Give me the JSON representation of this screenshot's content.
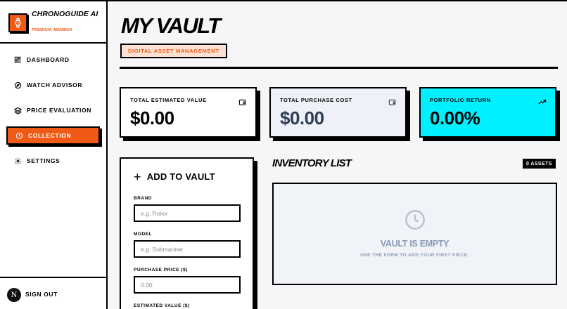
{
  "brand": {
    "title": "CHRONOGUIDE AI",
    "subtitle": "PREMIUM_MEMBER",
    "accent": "#ef5a16"
  },
  "nav": [
    {
      "label": "DASHBOARD",
      "icon": "dashboard-icon",
      "active": false
    },
    {
      "label": "WATCH ADVISOR",
      "icon": "compass-icon",
      "active": false
    },
    {
      "label": "PRICE EVALUATION",
      "icon": "layers-icon",
      "active": false
    },
    {
      "label": "COLLECTION",
      "icon": "clock-icon",
      "active": true
    },
    {
      "label": "SETTINGS",
      "icon": "gear-icon",
      "active": false
    }
  ],
  "footer": {
    "avatar_letter": "N",
    "signout_label": "SIGN OUT"
  },
  "page": {
    "title": "MY VAULT",
    "tag": "DIGITAL ASSET MANAGEMENT"
  },
  "cards": [
    {
      "label": "TOTAL ESTIMATED VALUE",
      "value": "$0.00",
      "icon": "wallet-icon",
      "bg": "#ffffff",
      "value_color": "#000000"
    },
    {
      "label": "TOTAL PURCHASE COST",
      "value": "$0.00",
      "icon": "wallet-icon",
      "bg": "#eef1f7",
      "value_color": "#2f3d55"
    },
    {
      "label": "PORTFOLIO RETURN",
      "value": "0.00%",
      "icon": "trending-up-icon",
      "bg": "#00f0ff",
      "value_color": "#000000"
    }
  ],
  "add_form": {
    "title": "ADD TO VAULT",
    "brand_label": "BRAND",
    "brand_placeholder": "e.g. Rolex",
    "model_label": "MODEL",
    "model_placeholder": "e.g. Submariner",
    "price_label": "PURCHASE PRICE ($)",
    "price_placeholder": "0.00",
    "estimate_label": "ESTIMATED VALUE ($)"
  },
  "inventory": {
    "title": "INVENTORY LIST",
    "count_badge": "0 ASSETS",
    "empty_title": "VAULT IS EMPTY",
    "empty_subtitle": "USE THE FORM TO ADD YOUR FIRST PIECE."
  }
}
